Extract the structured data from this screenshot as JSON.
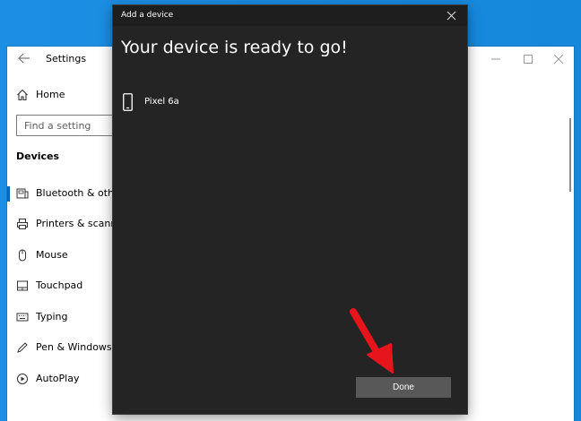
{
  "settings_window": {
    "title": "Settings",
    "home_label": "Home",
    "search_placeholder": "Find a setting",
    "section_title": "Devices",
    "nav_items": [
      {
        "label": "Bluetooth & other devices",
        "icon": "bluetooth-devices-icon"
      },
      {
        "label": "Printers & scanners",
        "icon": "printer-icon"
      },
      {
        "label": "Mouse",
        "icon": "mouse-icon"
      },
      {
        "label": "Touchpad",
        "icon": "touchpad-icon"
      },
      {
        "label": "Typing",
        "icon": "keyboard-icon"
      },
      {
        "label": "Pen & Windows Ink",
        "icon": "pen-icon"
      },
      {
        "label": "AutoPlay",
        "icon": "autoplay-icon"
      }
    ]
  },
  "dialog": {
    "title": "Add a device",
    "heading": "Your device is ready to go!",
    "device_name": "Pixel 6a",
    "done_label": "Done"
  },
  "colors": {
    "desktop": "#1c8fe4",
    "dialog_bg": "#242424",
    "button_bg": "#585858",
    "annotation_arrow": "#e8141c"
  }
}
